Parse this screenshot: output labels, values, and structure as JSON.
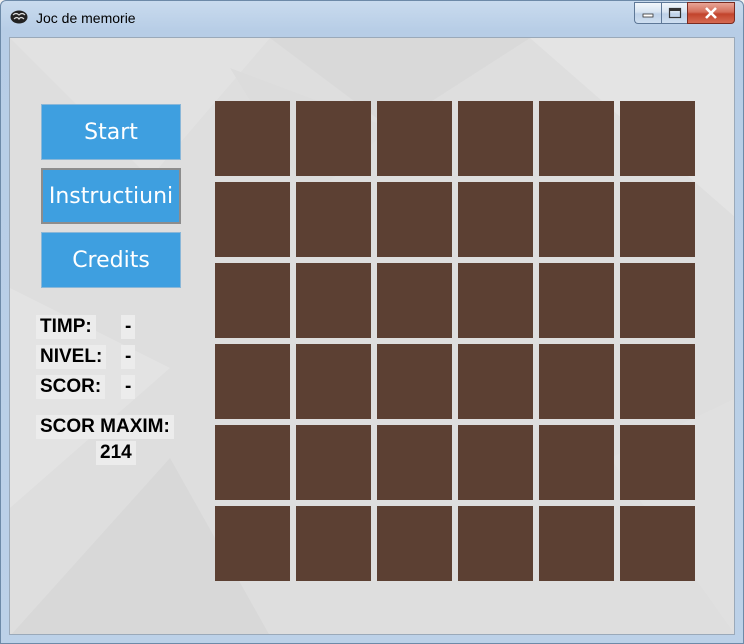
{
  "window": {
    "title": "Joc de memorie"
  },
  "menu": {
    "start_label": "Start",
    "instructions_label": "Instructiuni",
    "credits_label": "Credits"
  },
  "stats": {
    "time_label": "TIMP:",
    "time_value": "-",
    "level_label": "NIVEL:",
    "level_value": "-",
    "score_label": "SCOR:",
    "score_value": "-",
    "highscore_label": "SCOR MAXIM:",
    "highscore_value": "214"
  },
  "board": {
    "rows": 6,
    "cols": 6,
    "card_back_color": "#5c4033"
  },
  "colors": {
    "button": "#3e9fe0",
    "background": "#dedede"
  }
}
